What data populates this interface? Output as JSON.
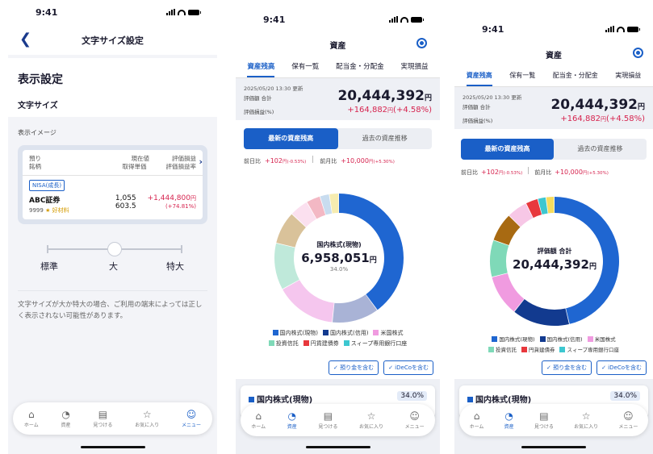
{
  "status": {
    "time": "9:41"
  },
  "screen1": {
    "nav_title": "文字サイズ設定",
    "section_title": "表示設定",
    "font_size_label": "文字サイズ",
    "preview_label": "表示イメージ",
    "preview": {
      "col1_top": "預り",
      "col1_bottom": "銘柄",
      "col2_top": "現在値",
      "col2_bottom": "取得単価",
      "col3_top": "評価損益",
      "col3_bottom": "評価損益率",
      "badge": "NISA(成長)",
      "name": "ABC証券",
      "code": "9999",
      "tag": "★ 好材料",
      "price": "1,055",
      "cost": "603.5",
      "pl": "+1,444,800",
      "pl_unit": "円",
      "pl_rate": "(+74.81%)"
    },
    "slider": {
      "labels": [
        "標準",
        "大",
        "特大"
      ],
      "selected": "大"
    },
    "note": "文字サイズが大か特大の場合、ご利用の端末によっては正しく表示されない可能性があります。"
  },
  "tabbar": [
    {
      "label": "ホーム",
      "icon": "home-icon",
      "glyph": "⌂"
    },
    {
      "label": "資産",
      "icon": "asset-pie-icon",
      "glyph": "◔"
    },
    {
      "label": "見つける",
      "icon": "find-document-icon",
      "glyph": "▤"
    },
    {
      "label": "お気に入り",
      "icon": "star-icon",
      "glyph": "☆"
    },
    {
      "label": "メニュー",
      "icon": "menu-user-icon",
      "glyph": "☺"
    }
  ],
  "assets": {
    "nav_title": "資産",
    "tabs": [
      "資産残高",
      "保有一覧",
      "配当金・分配金",
      "実現損益"
    ],
    "updated": "2025/05/20 13:30 更新",
    "total_label": "評価額 合計",
    "gain_label": "評価損益(%)",
    "total_value": "20,444,392",
    "unit": "円",
    "gain_value": "+164,882",
    "gain_rate": "(+4.58%)",
    "segments": [
      "最新の資産残高",
      "過去の資産推移"
    ],
    "day_label": "前日比",
    "day_value": "+102",
    "day_rate": "(-0.53%)",
    "month_label": "前月比",
    "month_value": "+10,000",
    "month_rate": "(+5.30%)",
    "center2": {
      "label": "国内株式(現物)",
      "value": "6,958,051",
      "unit": "円",
      "pct": "34.0%"
    },
    "center3": {
      "label": "評価額 合計",
      "value": "20,444,392",
      "unit": "円"
    },
    "legend": [
      {
        "name": "国内株式(現物)",
        "color": "#1f66d1"
      },
      {
        "name": "国内株式(信用)",
        "color": "#123a8f"
      },
      {
        "name": "米国株式",
        "color": "#f09be0"
      },
      {
        "name": "投資信託",
        "color": "#7fd9b8"
      },
      {
        "name": "円貨建債券",
        "color": "#e8383d"
      },
      {
        "name": "スィープ専用銀行口座",
        "color": "#3dc7d0"
      }
    ],
    "toggles": [
      "✓ 預り金を含む",
      "✓ iDeCoを含む"
    ],
    "bottom_title": "国内株式(現物)",
    "bottom_pct": "34.0%"
  }
}
